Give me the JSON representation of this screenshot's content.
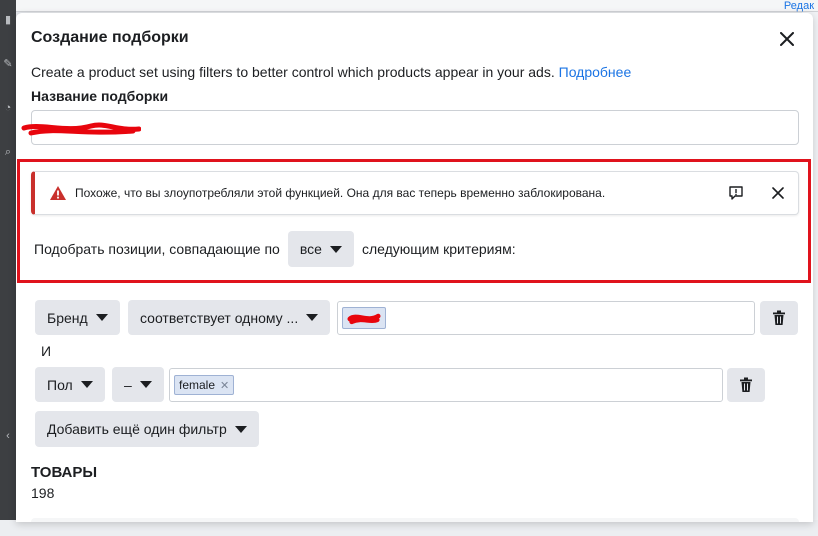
{
  "background": {
    "top_link": "Редак",
    "accent_color": "#1b74e4"
  },
  "modal": {
    "title": "Создание подборки",
    "description": "Create a product set using filters to better control which products appear in your ads.",
    "learn_more_link": "Подробнее",
    "name_label": "Название подборки",
    "name_value": "",
    "alert": {
      "text": "Похоже, что вы злоупотребляли этой функцией. Она для вас теперь временно заблокирована.",
      "icon": "warning-icon",
      "color": "#c9302c"
    },
    "match": {
      "prefix": "Подобрать позиции, совпадающие по",
      "selected": "все",
      "suffix": "следующим критериям:"
    },
    "filters": [
      {
        "field": "Бренд",
        "operator": "соответствует одному ...",
        "values": []
      },
      {
        "field": "Пол",
        "operator": "–",
        "values": [
          "female"
        ]
      }
    ],
    "and_label": "И",
    "add_filter_label": "Добавить ещё один фильтр",
    "products_title": "ТОВАРЫ",
    "products_count": "198"
  }
}
